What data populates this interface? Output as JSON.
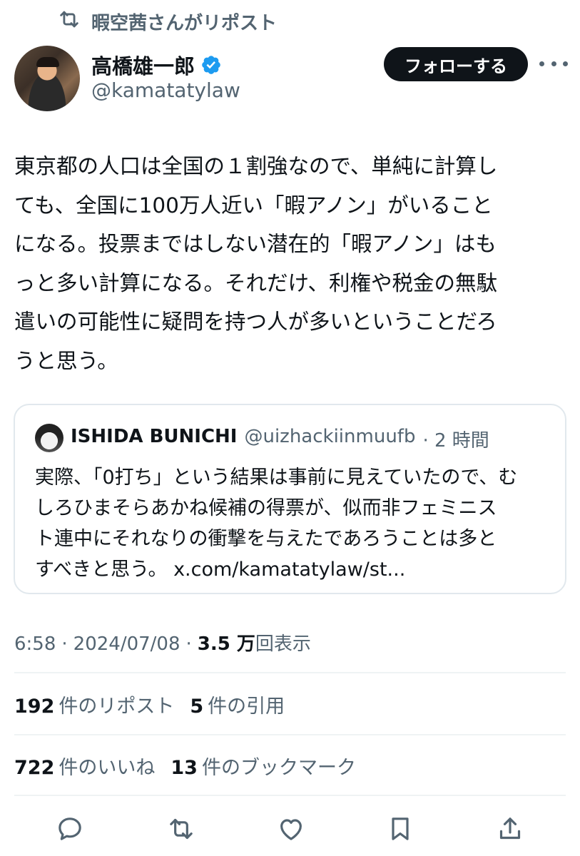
{
  "repost_header": {
    "text": "暇空茜さんがリポスト",
    "icon": "repost-icon"
  },
  "author": {
    "name": "高橋雄一郎",
    "handle": "@kamatatylaw",
    "verified": true,
    "verified_color": "#1d9bf0"
  },
  "follow_button": {
    "label": "フォローする"
  },
  "more_button": {
    "icon": "more-horizontal-icon"
  },
  "tweet": {
    "lines": [
      "東京都の人口は全国の１割強なので、単純に計算し",
      "ても、全国に100万人近い「暇アノン」がいること",
      "になる。投票まではしない潜在的「暇アノン」はも",
      "っと多い計算になる。それだけ、利権や税金の無駄",
      "遣いの可能性に疑問を持つ人が多いということだろ",
      "うと思う。"
    ]
  },
  "quote": {
    "name": "ISHIDA BUNICHI",
    "handle": "@uizhackiinmuufb",
    "time": "· 2 時間",
    "lines": [
      "実際、「0打ち」という結果は事前に見えていたので、む",
      "しろひまそらあかね候補の得票が、似而非フェミニス",
      "ト連中にそれなりの衝撃を与えたであろうことは多と",
      "すべきと思う。 x.com/kamatatylaw/st..."
    ]
  },
  "meta": {
    "time": "6:58",
    "sep1": "·",
    "date": "2024/07/08",
    "sep2": "·",
    "views_count": "3.5 万",
    "views_label": "回表示"
  },
  "stats_row1": {
    "reposts_count": "192",
    "reposts_label": "件のリポスト",
    "quotes_count": "5",
    "quotes_label": "件の引用"
  },
  "stats_row2": {
    "likes_count": "722",
    "likes_label": "件のいいね",
    "bookmarks_count": "13",
    "bookmarks_label": "件のブックマーク"
  },
  "actions": [
    "reply-icon",
    "repost-icon",
    "like-icon",
    "bookmark-icon",
    "share-icon"
  ],
  "colors": {
    "text": "#0f1419",
    "secondary": "#536471",
    "border": "#e1e8ed",
    "accent": "#1d9bf0"
  }
}
